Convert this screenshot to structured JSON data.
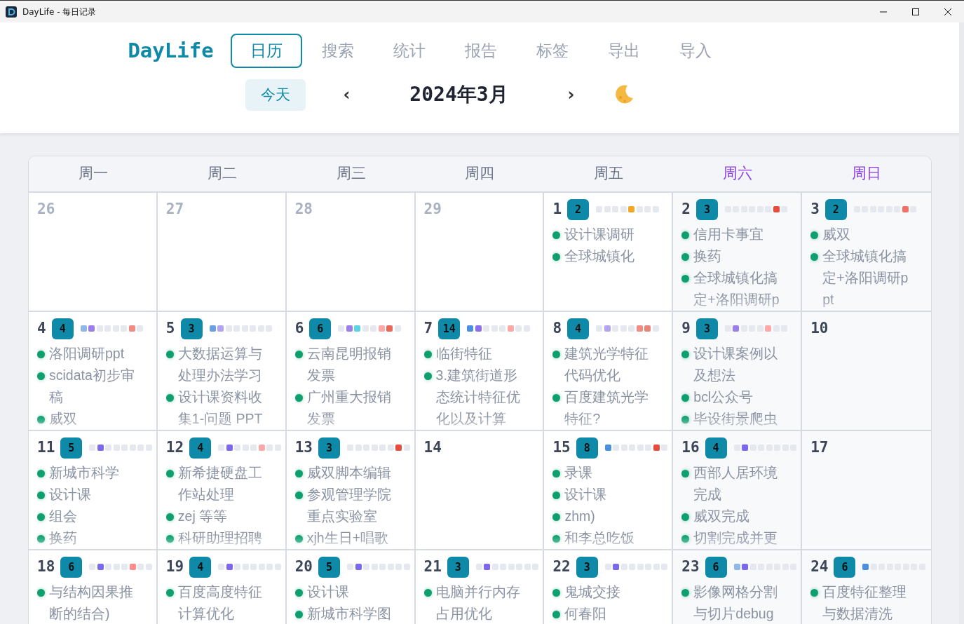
{
  "window": {
    "title": "DayLife - 每日记录"
  },
  "nav": {
    "logo": "DayLife",
    "tabs": [
      {
        "label": "日历",
        "selected": true
      },
      {
        "label": "搜索",
        "selected": false
      },
      {
        "label": "统计",
        "selected": false
      },
      {
        "label": "报告",
        "selected": false
      },
      {
        "label": "标签",
        "selected": false
      },
      {
        "label": "导出",
        "selected": false
      },
      {
        "label": "导入",
        "selected": false
      }
    ]
  },
  "toolbar": {
    "today": "今天",
    "prev": "‹",
    "month": "2024年3月",
    "next": "›"
  },
  "calendar": {
    "weekdays": [
      {
        "label": "周一",
        "weekend": false
      },
      {
        "label": "周二",
        "weekend": false
      },
      {
        "label": "周三",
        "weekend": false
      },
      {
        "label": "周四",
        "weekend": false
      },
      {
        "label": "周五",
        "weekend": false
      },
      {
        "label": "周六",
        "weekend": true
      },
      {
        "label": "周日",
        "weekend": true
      }
    ],
    "weeks": [
      [
        {
          "date": "26",
          "muted": true
        },
        {
          "date": "27",
          "muted": true
        },
        {
          "date": "28",
          "muted": true
        },
        {
          "date": "29",
          "muted": true
        },
        {
          "date": "1",
          "muted": false,
          "count": "2",
          "heat": [
            {
              "color": "#e5e8ee"
            },
            {
              "color": "#e5e8ee"
            },
            {
              "color": "#e5e8ee"
            },
            {
              "color": "#e5e8ee"
            },
            {
              "color": "#f5a623"
            },
            {
              "color": "#e5e8ee"
            },
            {
              "color": "#e5e8ee"
            },
            {
              "color": "#e5e8ee"
            }
          ],
          "items": [
            "设计课调研",
            "全球城镇化"
          ]
        },
        {
          "date": "2",
          "muted": false,
          "count": "3",
          "heat": [
            {
              "color": "#e5e8ee"
            },
            {
              "color": "#e5e8ee"
            },
            {
              "color": "#e5e8ee"
            },
            {
              "color": "#e5e8ee"
            },
            {
              "color": "#e5e8ee"
            },
            {
              "color": "#e5e8ee"
            },
            {
              "color": "#e74c3c"
            },
            {
              "color": "#e5e8ee"
            }
          ],
          "items": [
            "信用卡事宜",
            "换药",
            "全球城镇化搞定+洛阳调研p"
          ]
        },
        {
          "date": "3",
          "muted": false,
          "count": "2",
          "heat": [
            {
              "color": "#e5e8ee"
            },
            {
              "color": "#e5e8ee"
            },
            {
              "color": "#e5e8ee"
            },
            {
              "color": "#e5e8ee"
            },
            {
              "color": "#e5e8ee"
            },
            {
              "color": "#e5e8ee"
            },
            {
              "color": "#f07167"
            },
            {
              "color": "#e5e8ee"
            }
          ],
          "items": [
            "威双",
            "全球城镇化搞定+洛阳调研ppt"
          ]
        }
      ],
      [
        {
          "date": "4",
          "muted": false,
          "count": "4",
          "heat": [
            {
              "color": "#8fb8e8"
            },
            {
              "color": "#9b7fe8"
            },
            {
              "color": "#e5e8ee"
            },
            {
              "color": "#e5e8ee"
            },
            {
              "color": "#e5e8ee"
            },
            {
              "color": "#e5e8ee"
            },
            {
              "color": "#f28b82"
            },
            {
              "color": "#e5e8ee"
            }
          ],
          "items": [
            "洛阳调研ppt",
            "scidata初步审稿",
            "威双"
          ]
        },
        {
          "date": "5",
          "muted": false,
          "count": "3",
          "heat": [
            {
              "color": "#6a9fe0"
            },
            {
              "color": "#b3a4f0"
            },
            {
              "color": "#e5e8ee"
            },
            {
              "color": "#e5e8ee"
            },
            {
              "color": "#e5e8ee"
            },
            {
              "color": "#e5e8ee"
            },
            {
              "color": "#e5e8ee"
            },
            {
              "color": "#e5e8ee"
            }
          ],
          "items": [
            "大数据运算与处理办法学习",
            "设计课资料收集1-问题 PPT"
          ]
        },
        {
          "date": "6",
          "muted": false,
          "count": "6",
          "heat": [
            {
              "color": "#e5e8ee"
            },
            {
              "color": "#9b7fe8"
            },
            {
              "color": "#5ad4e0"
            },
            {
              "color": "#e5e8ee"
            },
            {
              "color": "#e5e8ee"
            },
            {
              "color": "#ffa8a8"
            },
            {
              "color": "#e8685a"
            },
            {
              "color": "#e5e8ee"
            }
          ],
          "items": [
            "云南昆明报销发票",
            "广州重大报销发票"
          ]
        },
        {
          "date": "7",
          "muted": false,
          "count": "14",
          "heat": [
            {
              "color": "#4a8fe0"
            },
            {
              "color": "#8b6ef0"
            },
            {
              "color": "#e5e8ee"
            },
            {
              "color": "#e5e8ee"
            },
            {
              "color": "#e5e8ee"
            },
            {
              "color": "#ffa8a8"
            },
            {
              "color": "#e5e8ee"
            },
            {
              "color": "#e5e8ee"
            }
          ],
          "items": [
            "临街特征",
            "3.建筑街道形态统计特征优化以及计算"
          ]
        },
        {
          "date": "8",
          "muted": false,
          "count": "4",
          "heat": [
            {
              "color": "#e5e8ee"
            },
            {
              "color": "#b3a4f0"
            },
            {
              "color": "#e5e8ee"
            },
            {
              "color": "#e5e8ee"
            },
            {
              "color": "#e5e8ee"
            },
            {
              "color": "#f28b82"
            },
            {
              "color": "#e8857a"
            },
            {
              "color": "#e5e8ee"
            }
          ],
          "items": [
            "建筑光学特征代码优化",
            "百度建筑光学特征?"
          ]
        },
        {
          "date": "9",
          "muted": false,
          "count": "3",
          "heat": [
            {
              "color": "#e5e8ee"
            },
            {
              "color": "#9b7fe8"
            },
            {
              "color": "#e5e8ee"
            },
            {
              "color": "#e5e8ee"
            },
            {
              "color": "#e5e8ee"
            },
            {
              "color": "#ffa8a8"
            },
            {
              "color": "#e5e8ee"
            },
            {
              "color": "#e5e8ee"
            }
          ],
          "items": [
            "设计课案例以及想法",
            "bcl公众号",
            "毕设街景爬虫"
          ]
        },
        {
          "date": "10",
          "muted": false
        }
      ],
      [
        {
          "date": "11",
          "muted": false,
          "count": "5",
          "heat": [
            {
              "color": "#e5e8ee"
            },
            {
              "color": "#7b68ee"
            },
            {
              "color": "#e5e8ee"
            },
            {
              "color": "#e5e8ee"
            },
            {
              "color": "#e5e8ee"
            },
            {
              "color": "#e5e8ee"
            },
            {
              "color": "#e5e8ee"
            },
            {
              "color": "#e5e8ee"
            }
          ],
          "items": [
            "新城市科学",
            "设计课",
            "组会",
            "换药"
          ]
        },
        {
          "date": "12",
          "muted": false,
          "count": "4",
          "heat": [
            {
              "color": "#e5e8ee"
            },
            {
              "color": "#7b68ee"
            },
            {
              "color": "#e5e8ee"
            },
            {
              "color": "#e5e8ee"
            },
            {
              "color": "#e5e8ee"
            },
            {
              "color": "#ffa8a8"
            },
            {
              "color": "#e5e8ee"
            },
            {
              "color": "#e5e8ee"
            }
          ],
          "items": [
            "新希捷硬盘工作站处理",
            "zej 等等",
            "科研助理招聘"
          ]
        },
        {
          "date": "13",
          "muted": false,
          "count": "3",
          "heat": [
            {
              "color": "#e5e8ee"
            },
            {
              "color": "#e5e8ee"
            },
            {
              "color": "#e5e8ee"
            },
            {
              "color": "#e5e8ee"
            },
            {
              "color": "#e5e8ee"
            },
            {
              "color": "#e5e8ee"
            },
            {
              "color": "#e74c3c"
            },
            {
              "color": "#e5e8ee"
            }
          ],
          "items": [
            "威双脚本编辑",
            "参观管理学院重点实验室",
            "xjh生日+唱歌"
          ]
        },
        {
          "date": "14",
          "muted": false
        },
        {
          "date": "15",
          "muted": false,
          "count": "8",
          "heat": [
            {
              "color": "#4a8fe0"
            },
            {
              "color": "#e5e8ee"
            },
            {
              "color": "#e5e8ee"
            },
            {
              "color": "#e5e8ee"
            },
            {
              "color": "#e5e8ee"
            },
            {
              "color": "#e5e8ee"
            },
            {
              "color": "#e74c3c"
            },
            {
              "color": "#e5e8ee"
            }
          ],
          "items": [
            "录课",
            "设计课",
            "zhm)",
            "和李总吃饭"
          ]
        },
        {
          "date": "16",
          "muted": false,
          "count": "4",
          "heat": [
            {
              "color": "#e5e8ee"
            },
            {
              "color": "#7b68ee"
            },
            {
              "color": "#e5e8ee"
            },
            {
              "color": "#e5e8ee"
            },
            {
              "color": "#e5e8ee"
            },
            {
              "color": "#e5e8ee"
            },
            {
              "color": "#e5e8ee"
            },
            {
              "color": "#e5e8ee"
            }
          ],
          "items": [
            "西部人居环境完成",
            "威双完成",
            "切割完成并更"
          ]
        },
        {
          "date": "17",
          "muted": false
        }
      ],
      [
        {
          "date": "18",
          "muted": false,
          "count": "6",
          "heat": [
            {
              "color": "#e5e8ee"
            },
            {
              "color": "#7b68ee"
            },
            {
              "color": "#e5e8ee"
            },
            {
              "color": "#e5e8ee"
            },
            {
              "color": "#e5e8ee"
            },
            {
              "color": "#ff8a8a"
            },
            {
              "color": "#e5e8ee"
            },
            {
              "color": "#e5e8ee"
            }
          ],
          "items": [
            "与结构因果推断的结合)"
          ]
        },
        {
          "date": "19",
          "muted": false,
          "count": "4",
          "heat": [
            {
              "color": "#e5e8ee"
            },
            {
              "color": "#7b68ee"
            },
            {
              "color": "#e5e8ee"
            },
            {
              "color": "#e5e8ee"
            },
            {
              "color": "#e5e8ee"
            },
            {
              "color": "#e5e8ee"
            },
            {
              "color": "#e5e8ee"
            },
            {
              "color": "#e5e8ee"
            }
          ],
          "items": [
            "百度高度特征计算优化"
          ]
        },
        {
          "date": "20",
          "muted": false,
          "count": "5",
          "heat": [
            {
              "color": "#e5e8ee"
            },
            {
              "color": "#7b68ee"
            },
            {
              "color": "#e5e8ee"
            },
            {
              "color": "#e5e8ee"
            },
            {
              "color": "#e5e8ee"
            },
            {
              "color": "#e5e8ee"
            },
            {
              "color": "#e5e8ee"
            },
            {
              "color": "#e5e8ee"
            }
          ],
          "items": [
            "设计课",
            "新城市科学图"
          ]
        },
        {
          "date": "21",
          "muted": false,
          "count": "3",
          "heat": [
            {
              "color": "#e5e8ee"
            },
            {
              "color": "#7b68ee"
            },
            {
              "color": "#e5e8ee"
            },
            {
              "color": "#e5e8ee"
            },
            {
              "color": "#e5e8ee"
            },
            {
              "color": "#e5e8ee"
            },
            {
              "color": "#e5e8ee"
            },
            {
              "color": "#e5e8ee"
            }
          ],
          "items": [
            "电脑并行内存占用优化"
          ]
        },
        {
          "date": "22",
          "muted": false,
          "count": "3",
          "heat": [
            {
              "color": "#e5e8ee"
            },
            {
              "color": "#7b68ee"
            },
            {
              "color": "#e5e8ee"
            },
            {
              "color": "#e5e8ee"
            },
            {
              "color": "#e5e8ee"
            },
            {
              "color": "#e5e8ee"
            },
            {
              "color": "#e5e8ee"
            },
            {
              "color": "#e5e8ee"
            }
          ],
          "items": [
            "鬼城交接",
            "何春阳"
          ]
        },
        {
          "date": "23",
          "muted": false,
          "count": "6",
          "heat": [
            {
              "color": "#8fb8e8"
            },
            {
              "color": "#7b68ee"
            },
            {
              "color": "#e5e8ee"
            },
            {
              "color": "#e5e8ee"
            },
            {
              "color": "#e5e8ee"
            },
            {
              "color": "#e5e8ee"
            },
            {
              "color": "#e5e8ee"
            },
            {
              "color": "#e5e8ee"
            }
          ],
          "items": [
            "影像网格分割与切片debug"
          ]
        },
        {
          "date": "24",
          "muted": false,
          "count": "6",
          "heat": [
            {
              "color": "#4a8fe0"
            },
            {
              "color": "#e5e8ee"
            },
            {
              "color": "#e5e8ee"
            },
            {
              "color": "#e5e8ee"
            },
            {
              "color": "#e5e8ee"
            },
            {
              "color": "#e5e8ee"
            },
            {
              "color": "#e5e8ee"
            },
            {
              "color": "#e5e8ee"
            }
          ],
          "items": [
            "百度特征整理与数据清洗"
          ]
        }
      ]
    ]
  }
}
